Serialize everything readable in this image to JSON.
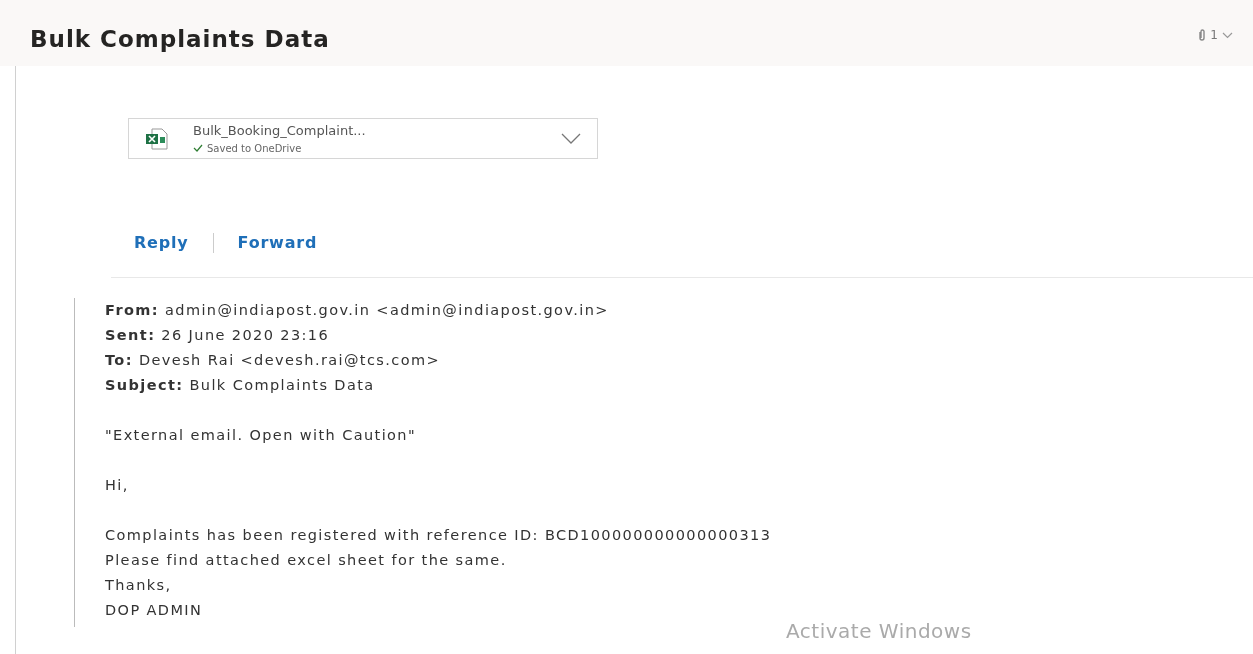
{
  "message": {
    "subject": "Bulk Complaints Data",
    "attachment_count": "1"
  },
  "attachment": {
    "file_name": "Bulk_Booking_Complaint...",
    "status": "Saved to OneDrive"
  },
  "actions": [
    "Reply",
    "Forward"
  ],
  "quoted_headers": [
    "**From:** admin@indiapost.gov.in <admin@indiapost.gov.in>",
    "**Sent:** 26 June 2020 23:16",
    "**To:** Devesh Rai <devesh.rai@tcs.com>",
    "**Subject:** Bulk Complaints Data"
  ],
  "body_paragraphs": [
    [
      "\"External email. Open with Caution\""
    ],
    [
      "Hi,"
    ],
    [
      "Complaints has been registered with reference ID: BCD100000000000000313",
      "Please find attached excel sheet for the same.",
      "Thanks,",
      "DOP ADMIN"
    ]
  ],
  "os_overlay": "Activate Windows"
}
